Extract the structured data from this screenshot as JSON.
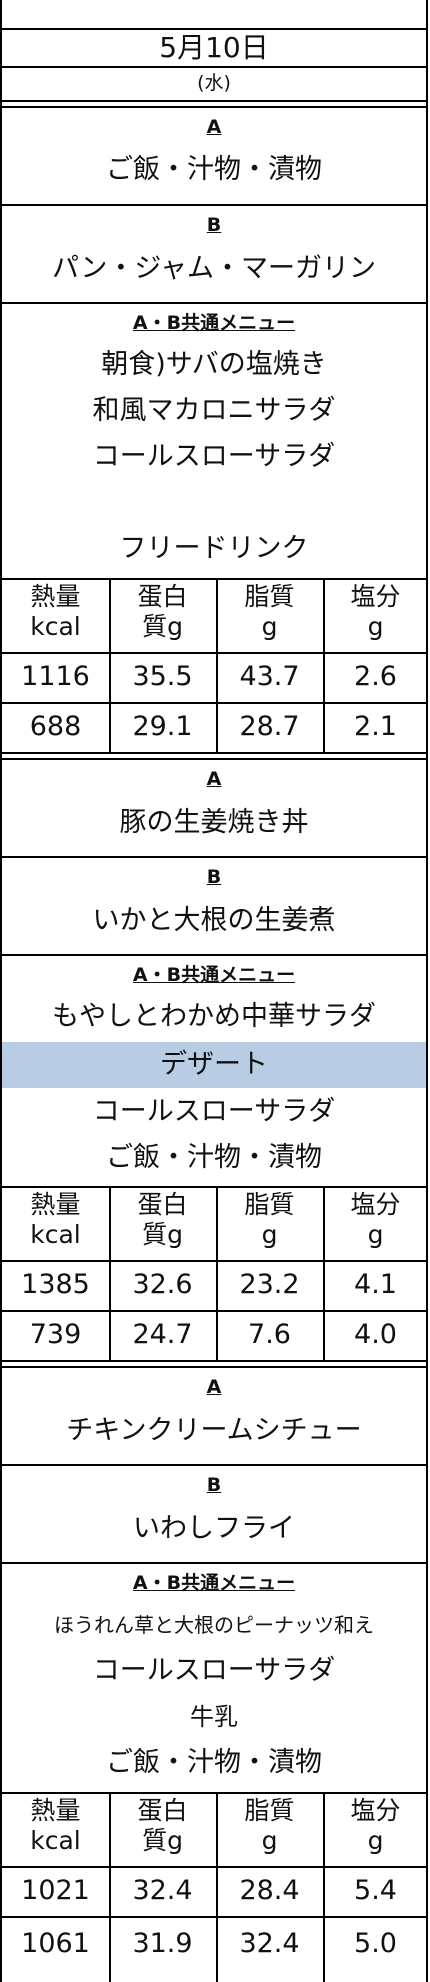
{
  "header": {
    "date": "5月10日",
    "weekday": "(水)"
  },
  "meals": [
    {
      "a_label": "A",
      "a_items": [
        "ご飯・汁物・漬物"
      ],
      "b_label": "B",
      "b_items": [
        "パン・ジャム・マーガリン"
      ],
      "common_label": "A・B共通メニュー",
      "common_items": [
        "朝食)サバの塩焼き",
        "和風マカロニサラダ",
        "コールスローサラダ",
        "",
        "フリードリンク"
      ],
      "nutrition_headers": [
        [
          "熱量",
          "kcal"
        ],
        [
          "蛋白",
          "質g"
        ],
        [
          "脂質",
          "g"
        ],
        [
          "塩分",
          "g"
        ]
      ],
      "nutrition_rows": [
        [
          "1116",
          "35.5",
          "43.7",
          "2.6"
        ],
        [
          "688",
          "29.1",
          "28.7",
          "2.1"
        ]
      ]
    },
    {
      "a_label": "A",
      "a_items": [
        "豚の生姜焼き丼"
      ],
      "b_label": "B",
      "b_items": [
        "いかと大根の生姜煮"
      ],
      "common_label": "A・B共通メニュー",
      "common_items": [
        "もやしとわかめ中華サラダ",
        "デザート",
        "コールスローサラダ",
        "ご飯・汁物・漬物"
      ],
      "highlight_index": 1,
      "nutrition_headers": [
        [
          "熱量",
          "kcal"
        ],
        [
          "蛋白",
          "質g"
        ],
        [
          "脂質",
          "g"
        ],
        [
          "塩分",
          "g"
        ]
      ],
      "nutrition_rows": [
        [
          "1385",
          "32.6",
          "23.2",
          "4.1"
        ],
        [
          "739",
          "24.7",
          "7.6",
          "4.0"
        ]
      ]
    },
    {
      "a_label": "A",
      "a_items": [
        "チキンクリームシチュー"
      ],
      "b_label": "B",
      "b_items": [
        "いわしフライ"
      ],
      "common_label": "A・B共通メニュー",
      "common_items": [
        "ほうれん草と大根のピーナッツ和え",
        "コールスローサラダ",
        "牛乳",
        "ご飯・汁物・漬物"
      ],
      "nutrition_headers": [
        [
          "熱量",
          "kcal"
        ],
        [
          "蛋白",
          "質g"
        ],
        [
          "脂質",
          "g"
        ],
        [
          "塩分",
          "g"
        ]
      ],
      "nutrition_rows": [
        [
          "1021",
          "32.4",
          "28.4",
          "5.4"
        ],
        [
          "1061",
          "31.9",
          "32.4",
          "5.0"
        ]
      ]
    }
  ],
  "colors": {
    "highlight_band": "#b8cce4",
    "rule": "#000000"
  }
}
